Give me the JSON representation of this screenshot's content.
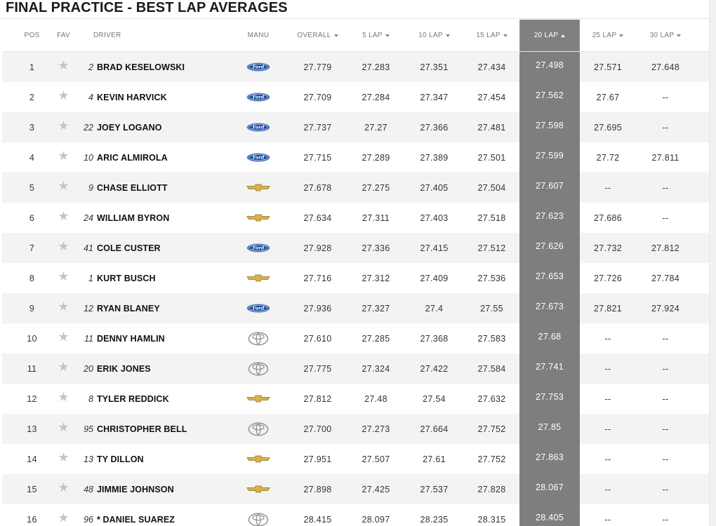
{
  "page_title": "FINAL PRACTICE - BEST LAP AVERAGES",
  "columns": {
    "pos": "POS",
    "fav": "FAV",
    "driver": "DRIVER",
    "manu": "MANU",
    "overall": "OVERALL",
    "lap5": "5 LAP",
    "lap10": "10 LAP",
    "lap15": "15 LAP",
    "lap20": "20 LAP",
    "lap25": "25 LAP",
    "lap30": "30 LAP"
  },
  "sorted_column": "20 LAP",
  "colors": {
    "sorted_column_bg": "#7e7e7e",
    "row_alt_bg": "#f3f3f3",
    "ford_blue": "#1d4f9e",
    "chevy_gold": "#d8b24a",
    "toyota_gray": "#8a8a8a"
  },
  "rows": [
    {
      "pos": "1",
      "car": "2",
      "driver": "BRAD KESELOWSKI",
      "manu": "ford-logo",
      "overall": "27.779",
      "lap5": "27.283",
      "lap10": "27.351",
      "lap15": "27.434",
      "lap20": "27.498",
      "lap25": "27.571",
      "lap30": "27.648"
    },
    {
      "pos": "2",
      "car": "4",
      "driver": "KEVIN HARVICK",
      "manu": "ford-logo",
      "overall": "27.709",
      "lap5": "27.284",
      "lap10": "27.347",
      "lap15": "27.454",
      "lap20": "27.562",
      "lap25": "27.67",
      "lap30": "--"
    },
    {
      "pos": "3",
      "car": "22",
      "driver": "JOEY LOGANO",
      "manu": "ford-logo",
      "overall": "27.737",
      "lap5": "27.27",
      "lap10": "27.366",
      "lap15": "27.481",
      "lap20": "27.598",
      "lap25": "27.695",
      "lap30": "--"
    },
    {
      "pos": "4",
      "car": "10",
      "driver": "ARIC ALMIROLA",
      "manu": "ford-logo",
      "overall": "27.715",
      "lap5": "27.289",
      "lap10": "27.389",
      "lap15": "27.501",
      "lap20": "27.599",
      "lap25": "27.72",
      "lap30": "27.811"
    },
    {
      "pos": "5",
      "car": "9",
      "driver": "CHASE ELLIOTT",
      "manu": "chevrolet-logo",
      "overall": "27.678",
      "lap5": "27.275",
      "lap10": "27.405",
      "lap15": "27.504",
      "lap20": "27.607",
      "lap25": "--",
      "lap30": "--"
    },
    {
      "pos": "6",
      "car": "24",
      "driver": "WILLIAM BYRON",
      "manu": "chevrolet-logo",
      "overall": "27.634",
      "lap5": "27.311",
      "lap10": "27.403",
      "lap15": "27.518",
      "lap20": "27.623",
      "lap25": "27.686",
      "lap30": "--"
    },
    {
      "pos": "7",
      "car": "41",
      "driver": "COLE CUSTER",
      "manu": "ford-logo",
      "overall": "27.928",
      "lap5": "27.336",
      "lap10": "27.415",
      "lap15": "27.512",
      "lap20": "27.626",
      "lap25": "27.732",
      "lap30": "27.812"
    },
    {
      "pos": "8",
      "car": "1",
      "driver": "KURT BUSCH",
      "manu": "chevrolet-logo",
      "overall": "27.716",
      "lap5": "27.312",
      "lap10": "27.409",
      "lap15": "27.536",
      "lap20": "27.653",
      "lap25": "27.726",
      "lap30": "27.784"
    },
    {
      "pos": "9",
      "car": "12",
      "driver": "RYAN BLANEY",
      "manu": "ford-logo",
      "overall": "27.936",
      "lap5": "27.327",
      "lap10": "27.4",
      "lap15": "27.55",
      "lap20": "27.673",
      "lap25": "27.821",
      "lap30": "27.924"
    },
    {
      "pos": "10",
      "car": "11",
      "driver": "DENNY HAMLIN",
      "manu": "toyota-logo",
      "overall": "27.610",
      "lap5": "27.285",
      "lap10": "27.368",
      "lap15": "27.583",
      "lap20": "27.68",
      "lap25": "--",
      "lap30": "--"
    },
    {
      "pos": "11",
      "car": "20",
      "driver": "ERIK JONES",
      "manu": "toyota-logo",
      "overall": "27.775",
      "lap5": "27.324",
      "lap10": "27.422",
      "lap15": "27.584",
      "lap20": "27.741",
      "lap25": "--",
      "lap30": "--"
    },
    {
      "pos": "12",
      "car": "8",
      "driver": "TYLER REDDICK",
      "manu": "chevrolet-logo",
      "overall": "27.812",
      "lap5": "27.48",
      "lap10": "27.54",
      "lap15": "27.632",
      "lap20": "27.753",
      "lap25": "--",
      "lap30": "--"
    },
    {
      "pos": "13",
      "car": "95",
      "driver": "CHRISTOPHER BELL",
      "manu": "toyota-logo",
      "overall": "27.700",
      "lap5": "27.273",
      "lap10": "27.664",
      "lap15": "27.752",
      "lap20": "27.85",
      "lap25": "--",
      "lap30": "--"
    },
    {
      "pos": "14",
      "car": "13",
      "driver": "TY DILLON",
      "manu": "chevrolet-logo",
      "overall": "27.951",
      "lap5": "27.507",
      "lap10": "27.61",
      "lap15": "27.752",
      "lap20": "27.863",
      "lap25": "--",
      "lap30": "--"
    },
    {
      "pos": "15",
      "car": "48",
      "driver": "JIMMIE JOHNSON",
      "manu": "chevrolet-logo",
      "overall": "27.898",
      "lap5": "27.425",
      "lap10": "27.537",
      "lap15": "27.828",
      "lap20": "28.067",
      "lap25": "--",
      "lap30": "--"
    },
    {
      "pos": "16",
      "car": "96",
      "driver": "* DANIEL SUAREZ",
      "manu": "toyota-logo",
      "overall": "28.415",
      "lap5": "28.097",
      "lap10": "28.235",
      "lap15": "28.315",
      "lap20": "28.405",
      "lap25": "--",
      "lap30": "--"
    }
  ]
}
